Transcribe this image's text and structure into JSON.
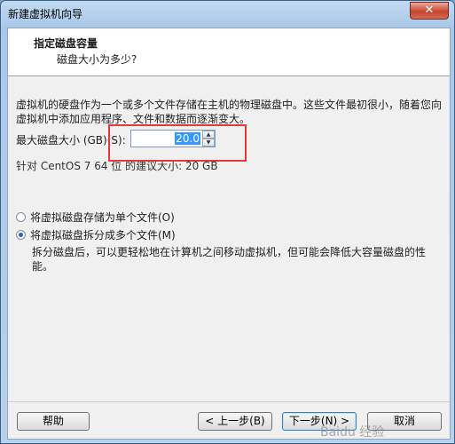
{
  "window": {
    "title": "新建虚拟机向导",
    "close_label": "✕"
  },
  "header": {
    "title": "指定磁盘容量",
    "subtitle": "磁盘大小为多少?"
  },
  "content": {
    "description": "虚拟机的硬盘作为一个或多个文件存储在主机的物理磁盘中。这些文件最初很小，随着您向虚拟机中添加应用程序、文件和数据而逐渐变大。",
    "disk_size_label": "最大磁盘大小 (GB)(S):",
    "disk_size_value": "20.0",
    "recommended_text": "针对 CentOS 7 64 位 的建议大小: 20 GB",
    "options": [
      {
        "label": "将虚拟磁盘存储为单个文件(O)",
        "selected": false
      },
      {
        "label": "将虚拟磁盘拆分成多个文件(M)",
        "selected": true
      }
    ],
    "split_description": "拆分磁盘后，可以更轻松地在计算机之间移动虚拟机，但可能会降低大容量磁盘的性能。"
  },
  "buttons": {
    "help": "帮助",
    "back": "< 上一步(B)",
    "next": "下一步(N) >",
    "cancel": "取消"
  },
  "overlay": {
    "watermark": "Baidu 经验",
    "highlight_color": "#e23a3a"
  }
}
